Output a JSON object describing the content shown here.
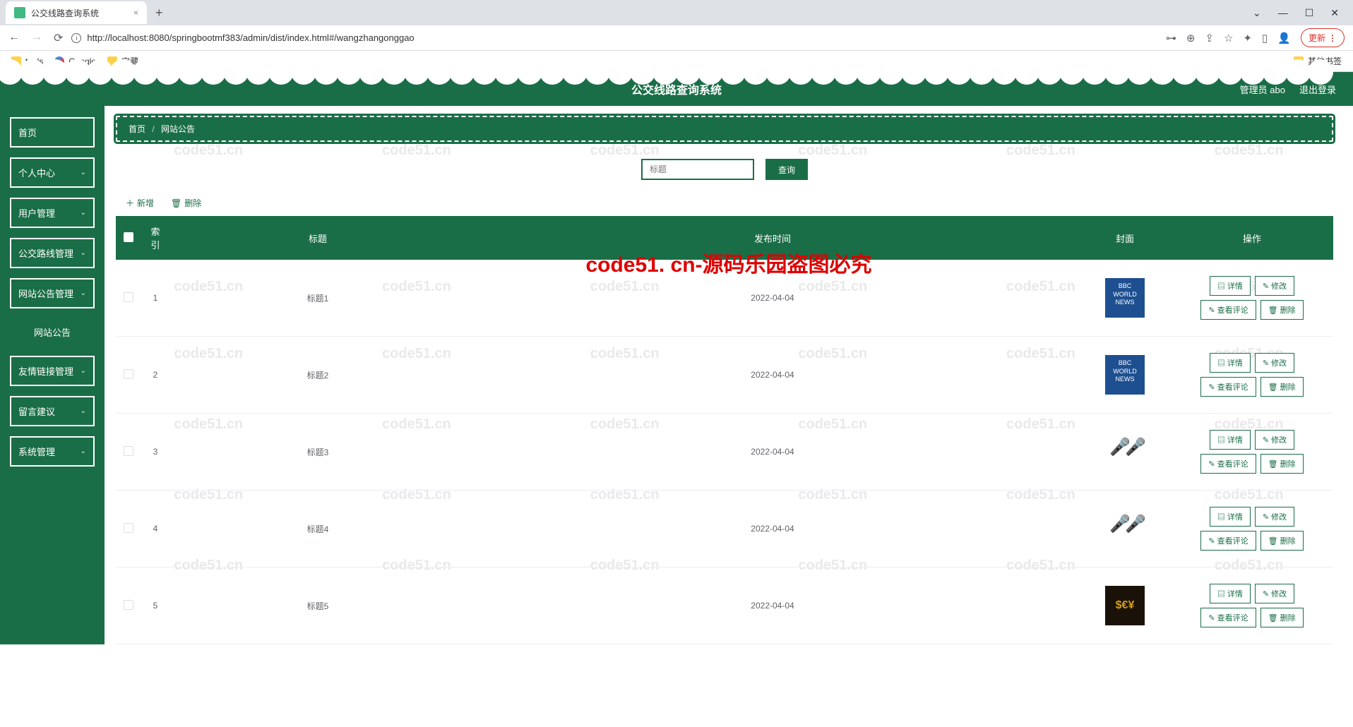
{
  "browser": {
    "tab_title": "公交线路查询系统",
    "url": "http://localhost:8080/springbootmf383/admin/dist/index.html#/wangzhangonggao",
    "update": "更新",
    "bookmarks": {
      "tools": "tools",
      "google": "Google",
      "treasure": "宝藏",
      "other": "其他书签"
    }
  },
  "header": {
    "title": "公交线路查询系统",
    "admin": "管理员 abo",
    "logout": "退出登录"
  },
  "sidebar": {
    "items": [
      {
        "label": "首页",
        "expand": false
      },
      {
        "label": "个人中心",
        "expand": true
      },
      {
        "label": "用户管理",
        "expand": true
      },
      {
        "label": "公交路线管理",
        "expand": true
      },
      {
        "label": "网站公告管理",
        "expand": true
      },
      {
        "label": "网站公告",
        "sub": true
      },
      {
        "label": "友情链接管理",
        "expand": true
      },
      {
        "label": "留言建议",
        "expand": true
      },
      {
        "label": "系统管理",
        "expand": true
      }
    ]
  },
  "breadcrumb": {
    "home": "首页",
    "current": "网站公告"
  },
  "search": {
    "placeholder": "标题",
    "query": "查询"
  },
  "toolbar": {
    "add": "新增",
    "delete": "删除"
  },
  "table": {
    "headers": {
      "index": "索引",
      "title": "标题",
      "time": "发布时间",
      "cover": "封面",
      "ops": "操作"
    },
    "btns": {
      "detail": "详情",
      "edit": "修改",
      "comments": "查看评论",
      "delete": "删除"
    },
    "rows": [
      {
        "idx": "1",
        "title": "标题1",
        "time": "2022-04-04",
        "cover": "bbc"
      },
      {
        "idx": "2",
        "title": "标题2",
        "time": "2022-04-04",
        "cover": "bbc"
      },
      {
        "idx": "3",
        "title": "标题3",
        "time": "2022-04-04",
        "cover": "mic"
      },
      {
        "idx": "4",
        "title": "标题4",
        "time": "2022-04-04",
        "cover": "mic"
      },
      {
        "idx": "5",
        "title": "标题5",
        "time": "2022-04-04",
        "cover": "money"
      }
    ]
  },
  "watermark": "code51.cn",
  "big_watermark": "code51. cn-源码乐园盗图必究"
}
